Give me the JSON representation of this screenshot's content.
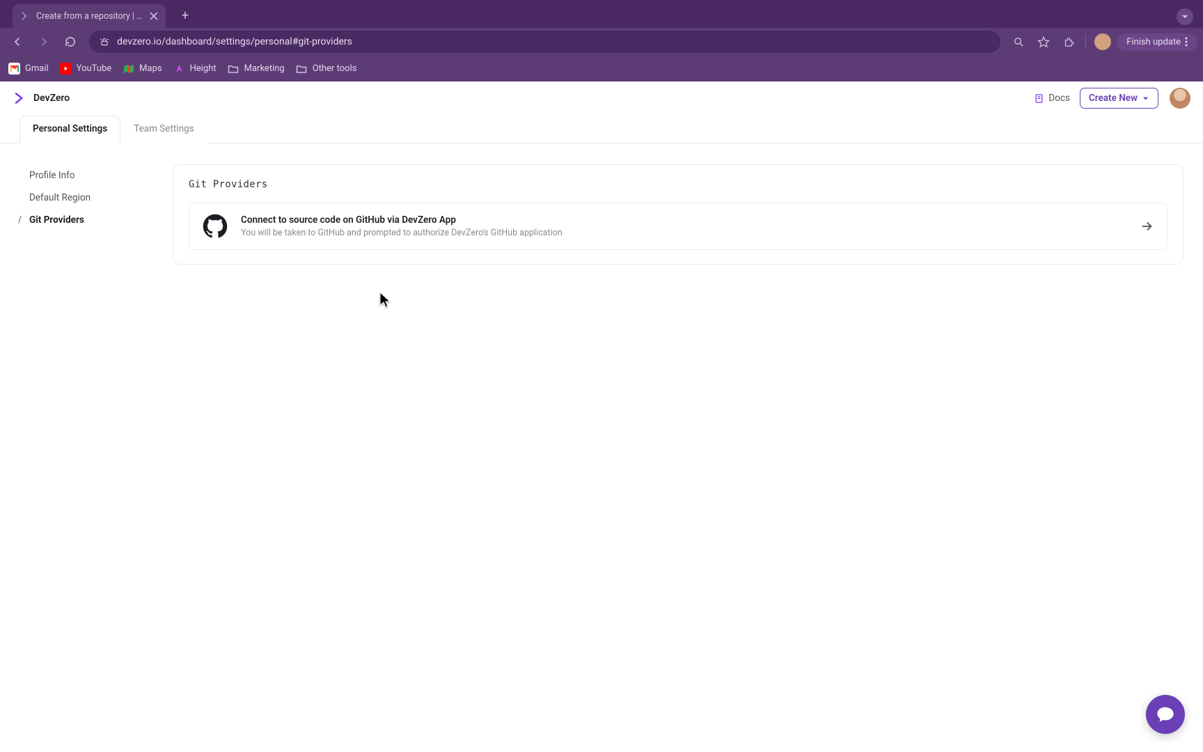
{
  "browser": {
    "tab_title": "Create from a repository | De",
    "url": "devzero.io/dashboard/settings/personal#git-providers",
    "finish_update": "Finish update",
    "bookmarks": [
      {
        "label": "Gmail"
      },
      {
        "label": "YouTube"
      },
      {
        "label": "Maps"
      },
      {
        "label": "Height"
      },
      {
        "label": "Marketing"
      },
      {
        "label": "Other tools"
      }
    ]
  },
  "header": {
    "brand": "DevZero",
    "docs": "Docs",
    "create_new": "Create New"
  },
  "tabs": {
    "personal": "Personal Settings",
    "team": "Team Settings"
  },
  "sidebar": {
    "items": [
      {
        "label": "Profile Info"
      },
      {
        "label": "Default Region"
      },
      {
        "label": "Git Providers"
      }
    ]
  },
  "panel": {
    "title": "Git Providers",
    "provider": {
      "title": "Connect to source code on GitHub via DevZero App",
      "subtitle": "You will be taken to GitHub and prompted to authorize DevZero's GitHub application"
    }
  }
}
